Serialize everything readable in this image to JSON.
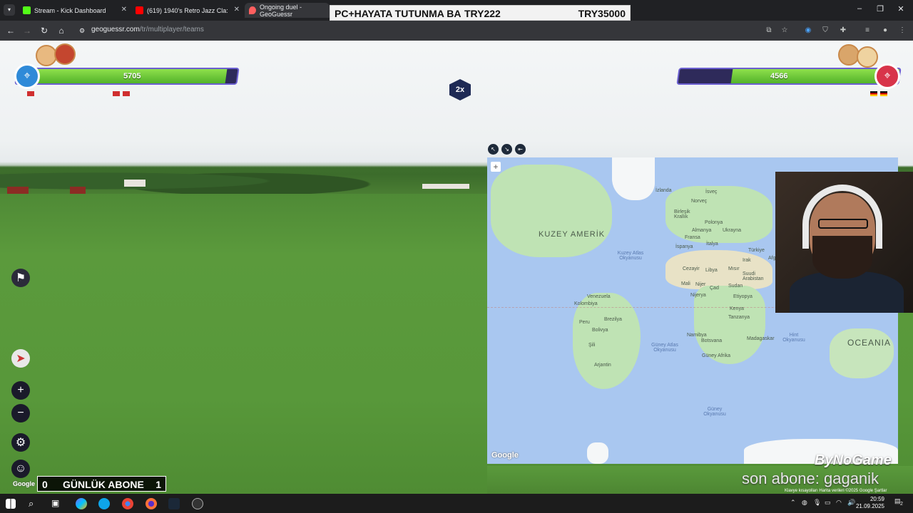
{
  "browser": {
    "tabs": [
      {
        "label": "Stream - Kick Dashboard",
        "favicon_color": "#53fc18"
      },
      {
        "label": "(619) 1940's Retro Jazz Cla:",
        "favicon_color": "#ff0000"
      },
      {
        "label": "Ongoing duel - GeoGuessr",
        "favicon_color": "#ff5f5f"
      }
    ],
    "url_host": "geoguessr.com",
    "url_path": "/tr/multiplayer/teams"
  },
  "banner": {
    "left": "PC+HAYATA TUTUNMA BA",
    "mid": "TRY222",
    "right": "TRY35000"
  },
  "game": {
    "left_team": {
      "score": "5705",
      "health_fraction": 0.95,
      "color": "#2f8ad8"
    },
    "right_team": {
      "score": "4566",
      "health_fraction": 0.76,
      "color": "#d8344a"
    },
    "multiplier": "2x",
    "google_label": "Google"
  },
  "map": {
    "labels": {
      "north_america": "KUZEY AMERİK",
      "north_atlantic": "Kuzey Atlas Okyanusu",
      "south_atlantic": "Güney Atlas Okyanusu",
      "indian": "Hint Okyanusu",
      "southern": "Güney Okyanusu",
      "oceania": "OCEANIA",
      "iceland": "İzlanda",
      "sweden": "İsveç",
      "norway": "Norveç",
      "uk": "Birleşik Krallık",
      "poland": "Polonya",
      "ukraine": "Ukrayna",
      "germany": "Almanya",
      "france": "Fransa",
      "spain": "İspanya",
      "italy": "İtalya",
      "turkey": "Türkiye",
      "iraq": "Irak",
      "algeria": "Cezayir",
      "libya": "Libya",
      "egypt": "Mısır",
      "saudi": "Suudi Arabistan",
      "mali": "Mali",
      "niger": "Nijer",
      "chad": "Çad",
      "sudan": "Sudan",
      "nigeria": "Nijerya",
      "ethiopia": "Etiyopya",
      "kenya": "Kenya",
      "tanzania": "Tanzanya",
      "namibia": "Namibya",
      "botswana": "Botsvana",
      "madagascar": "Madagaskar",
      "south_africa": "Güney Afrika",
      "venezuela": "Venezuela",
      "colombia": "Kolombiya",
      "brazil": "Brezilya",
      "peru": "Peru",
      "bolivia": "Bolivya",
      "chile": "Şili",
      "argentina": "Arjantin",
      "afg": "Afg"
    },
    "google_label": "Google",
    "attribution": "Klavye kısayolları  Harita verileri ©2025 Google  Şartlar"
  },
  "overlay": {
    "sub_left": "0",
    "sub_title": "GÜNLÜK ABONE",
    "sub_right": "1",
    "last_sub": "son abone: gaganik",
    "brand": "ByNoGame"
  },
  "taskbar": {
    "time": "20:59",
    "date": "21.09.2025",
    "notif": "2"
  }
}
